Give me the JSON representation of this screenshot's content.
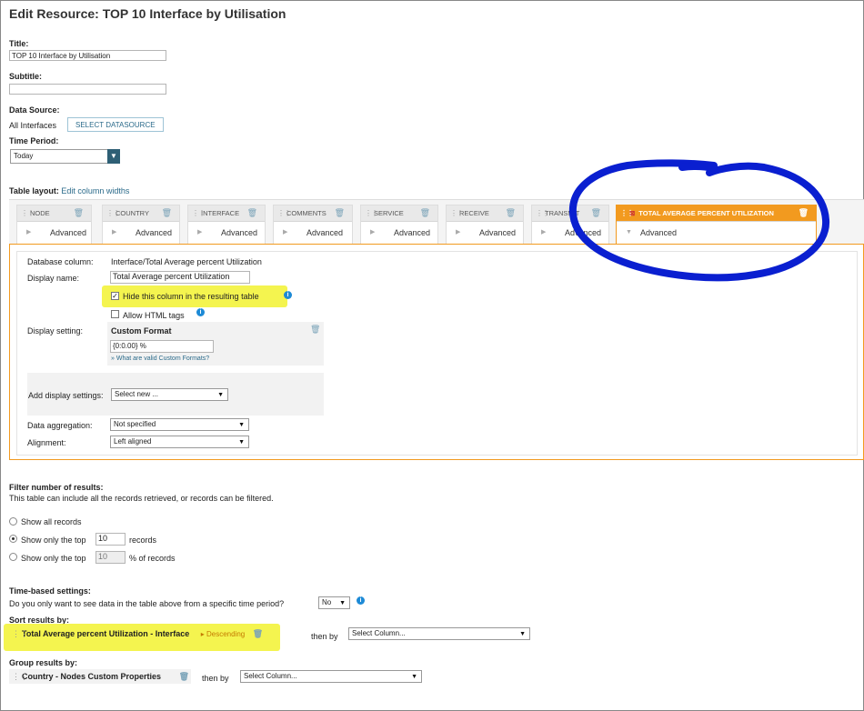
{
  "page": {
    "title": "Edit Resource: TOP 10 Interface by Utilisation"
  },
  "form": {
    "title_label": "Title:",
    "title_value": "TOP 10 Interface by Utilisation",
    "subtitle_label": "Subtitle:",
    "subtitle_value": "",
    "datasource_label": "Data Source:",
    "datasource_value": "All Interfaces",
    "select_datasource_button": "SELECT DATASOURCE",
    "time_period_label": "Time Period:",
    "time_period_value": "Today"
  },
  "table_layout": {
    "label": "Table layout:",
    "edit_link": "Edit column widths",
    "advanced_label": "Advanced",
    "columns": [
      {
        "name": "NODE"
      },
      {
        "name": "COUNTRY"
      },
      {
        "name": "INTERFACE"
      },
      {
        "name": "COMMENTS"
      },
      {
        "name": "SERVICE"
      },
      {
        "name": "RECEIVE"
      },
      {
        "name": "TRANSMIT"
      },
      {
        "name": "TOTAL AVERAGE PERCENT UTILIZATION",
        "active": true
      }
    ]
  },
  "column_editor": {
    "db_column_label": "Database column:",
    "db_column_value": "Interface/Total Average percent Utilization",
    "display_name_label": "Display name:",
    "display_name_value": "Total Average percent Utilization",
    "hide_column_label": "Hide this column in the resulting table",
    "hide_column_checked": true,
    "allow_html_label": "Allow HTML tags",
    "allow_html_checked": false,
    "display_setting_label": "Display setting:",
    "custom_format_title": "Custom Format",
    "custom_format_value": "{0:0.00} %",
    "custom_format_help": "What are valid Custom Formats?",
    "add_display_label": "Add display settings:",
    "add_display_value": "Select new ...",
    "aggregation_label": "Data aggregation:",
    "aggregation_value": "Not specified",
    "alignment_label": "Alignment:",
    "alignment_value": "Left aligned"
  },
  "filter": {
    "heading": "Filter number of results:",
    "description": "This table can include all the records retrieved, or records can be filtered.",
    "show_all": "Show all records",
    "show_top_prefix": "Show only the top",
    "show_top_value": "10",
    "show_top_suffix": "records",
    "show_pct_prefix": "Show only the top",
    "show_pct_value": "10",
    "show_pct_suffix": "% of records",
    "selected": "top"
  },
  "time_based": {
    "heading": "Time-based settings:",
    "question": "Do you only want to see data in the table above from a specific time period?",
    "value": "No"
  },
  "sort": {
    "heading": "Sort results by:",
    "field": "Total Average percent Utilization - Interface",
    "direction": "Descending",
    "then_by": "then by",
    "then_value": "Select Column..."
  },
  "group": {
    "heading": "Group results by:",
    "field": "Country - Nodes Custom Properties",
    "then_by": "then by",
    "then_value": "Select Column..."
  },
  "annotations": {
    "highlight_color": "#f3f33c",
    "circle_color": "#0a1fd0",
    "accent_color": "#f29a1f",
    "brand_color": "#2e5f75"
  }
}
